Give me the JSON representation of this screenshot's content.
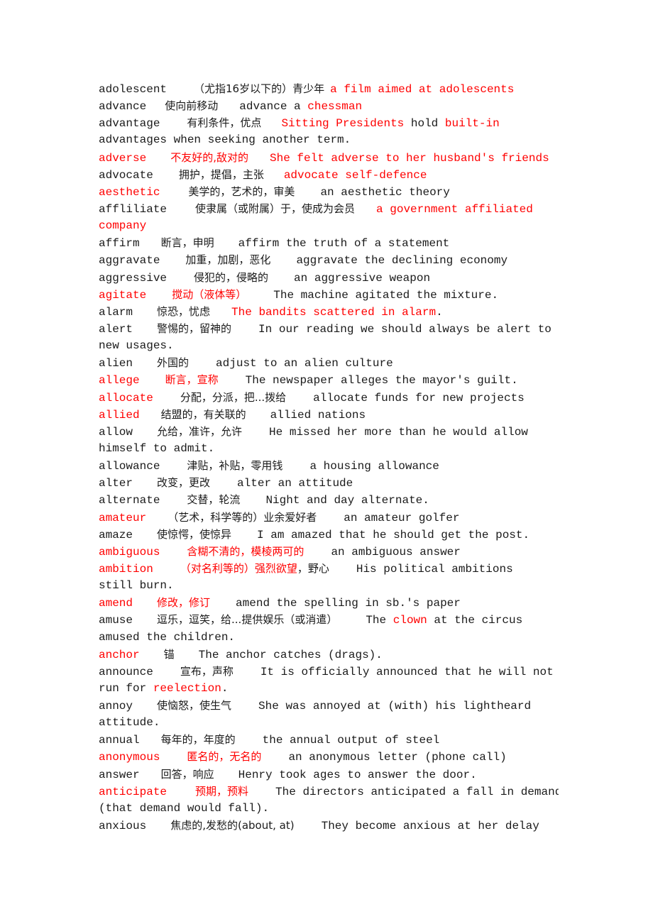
{
  "colors": {
    "text": "#1a1a1a",
    "highlight": "#ff0000"
  },
  "lines": [
    [
      {
        "t": "adolescent"
      },
      {
        "g": 38
      },
      {
        "t": "（尤指16岁以下的）青少年",
        "zh": 1
      },
      {
        "g": 8
      },
      {
        "t": "a film aimed at adolescents",
        "r": 1
      }
    ],
    [
      {
        "t": "advance"
      },
      {
        "g": 26
      },
      {
        "t": "使向前移动",
        "zh": 1
      },
      {
        "g": 30
      },
      {
        "t": "advance a "
      },
      {
        "t": "chessman",
        "r": 1
      }
    ],
    [
      {
        "t": "advantage"
      },
      {
        "g": 38
      },
      {
        "t": "有利条件，优点",
        "zh": 1
      },
      {
        "g": 28
      },
      {
        "t": "Sitting Presidents",
        "r": 1
      },
      {
        "t": " hold "
      },
      {
        "t": "built-in",
        "r": 1
      }
    ],
    [
      {
        "t": "advantages when seeking another term."
      }
    ],
    [
      {
        "t": "adverse",
        "r": 1
      },
      {
        "g": 34
      },
      {
        "t": "不友好的,敌对的",
        "zh": 1,
        "r": 1
      },
      {
        "g": 30
      },
      {
        "t": "She felt adverse to her husband's friends",
        "r": 1
      }
    ],
    [
      {
        "t": "advocate"
      },
      {
        "g": 36
      },
      {
        "t": "拥护，提倡，主张",
        "zh": 1
      },
      {
        "g": 28
      },
      {
        "t": "advocate self-defence",
        "r": 1
      }
    ],
    [
      {
        "t": "aesthetic",
        "r": 1
      },
      {
        "g": 40
      },
      {
        "t": "美学的，艺术的，审美",
        "zh": 1
      },
      {
        "g": 36
      },
      {
        "t": "an aesthetic theory"
      }
    ],
    [
      {
        "t": "affliliate"
      },
      {
        "g": 40
      },
      {
        "t": "使隶属（或附属）于，使成为会员",
        "zh": 1
      },
      {
        "g": 30
      },
      {
        "t": "a government affiliated",
        "r": 1
      }
    ],
    [
      {
        "t": "company",
        "r": 1
      }
    ],
    [
      {
        "t": "affirm"
      },
      {
        "g": 30
      },
      {
        "t": "断言，申明",
        "zh": 1
      },
      {
        "g": 34
      },
      {
        "t": "affirm the truth of a statement"
      }
    ],
    [
      {
        "t": "aggravate"
      },
      {
        "g": 36
      },
      {
        "t": "加重，加剧，恶化",
        "zh": 1
      },
      {
        "g": 36
      },
      {
        "t": "aggravate the declining economy"
      }
    ],
    [
      {
        "t": "aggressive"
      },
      {
        "g": 38
      },
      {
        "t": "侵犯的，侵略的",
        "zh": 1
      },
      {
        "g": 36
      },
      {
        "t": "an aggressive weapon"
      }
    ],
    [
      {
        "t": "agitate",
        "r": 1
      },
      {
        "g": 36
      },
      {
        "t": "搅动（液体等）",
        "zh": 1,
        "r": 1
      },
      {
        "g": 38
      },
      {
        "t": "The machine agitated the mixture."
      }
    ],
    [
      {
        "t": "alarm"
      },
      {
        "g": 34
      },
      {
        "t": "惊恐，忧虑",
        "zh": 1
      },
      {
        "g": 30
      },
      {
        "t": "The bandits scattered in alarm",
        "r": 1
      },
      {
        "t": "."
      }
    ],
    [
      {
        "t": "alert"
      },
      {
        "g": 34
      },
      {
        "t": "警惕的，留神的",
        "zh": 1
      },
      {
        "g": 38
      },
      {
        "t": "In our reading we should always be alert to"
      }
    ],
    [
      {
        "t": "new usages."
      }
    ],
    [
      {
        "t": "alien"
      },
      {
        "g": 34
      },
      {
        "t": "外国的",
        "zh": 1
      },
      {
        "g": 38
      },
      {
        "t": "adjust to an alien culture"
      }
    ],
    [
      {
        "t": "allege",
        "r": 1
      },
      {
        "g": 36
      },
      {
        "t": "断言，宣称",
        "zh": 1,
        "r": 1
      },
      {
        "g": 38
      },
      {
        "t": "The newspaper alleges the mayor's guilt."
      }
    ],
    [
      {
        "t": "allocate",
        "r": 1
      },
      {
        "g": 38
      },
      {
        "t": "分配，分派，把...拨给",
        "zh": 1
      },
      {
        "g": 38
      },
      {
        "t": "allocate funds for new projects"
      }
    ],
    [
      {
        "t": "allied",
        "r": 1
      },
      {
        "g": 30
      },
      {
        "t": "结盟的，有关联的",
        "zh": 1
      },
      {
        "g": 34
      },
      {
        "t": "allied nations"
      }
    ],
    [
      {
        "t": "allow"
      },
      {
        "g": 34
      },
      {
        "t": "允给，准许，允许",
        "zh": 1
      },
      {
        "g": 38
      },
      {
        "t": "He missed her more than he would allow"
      }
    ],
    [
      {
        "t": "himself to admit."
      }
    ],
    [
      {
        "t": "allowance"
      },
      {
        "g": 38
      },
      {
        "t": "津贴，补贴，零用钱",
        "zh": 1
      },
      {
        "g": 38
      },
      {
        "t": "a housing allowance"
      }
    ],
    [
      {
        "t": "alter"
      },
      {
        "g": 34
      },
      {
        "t": "改变，更改",
        "zh": 1
      },
      {
        "g": 38
      },
      {
        "t": "alter an attitude"
      }
    ],
    [
      {
        "t": "alternate"
      },
      {
        "g": 38
      },
      {
        "t": "交替，轮流",
        "zh": 1
      },
      {
        "g": 36
      },
      {
        "t": "Night and day alternate."
      }
    ],
    [
      {
        "t": "amateur",
        "r": 1
      },
      {
        "g": 30
      },
      {
        "t": "（艺术，科学等的）业余爱好者",
        "zh": 1
      },
      {
        "g": 38
      },
      {
        "t": "an amateur golfer"
      }
    ],
    [
      {
        "t": "amaze"
      },
      {
        "g": 34
      },
      {
        "t": "使惊愕，使惊异",
        "zh": 1
      },
      {
        "g": 36
      },
      {
        "t": "I am amazed that he should get the post."
      }
    ],
    [
      {
        "t": "ambiguous",
        "r": 1
      },
      {
        "g": 38
      },
      {
        "t": "含糊不清的，模棱两可的",
        "zh": 1,
        "r": 1
      },
      {
        "g": 38
      },
      {
        "t": "an ambiguous answer"
      }
    ],
    [
      {
        "t": "ambition",
        "r": 1
      },
      {
        "g": 38
      },
      {
        "t": "（对名利等的）强烈欲望",
        "zh": 1,
        "r": 1
      },
      {
        "t": "，野心",
        "zh": 1
      },
      {
        "g": 38
      },
      {
        "t": "His political ambitions"
      }
    ],
    [
      {
        "t": "still burn."
      }
    ],
    [
      {
        "t": "amend",
        "r": 1
      },
      {
        "g": 34
      },
      {
        "t": "修改，修订",
        "zh": 1,
        "r": 1
      },
      {
        "g": 36
      },
      {
        "t": "amend the spelling in sb.'s paper"
      }
    ],
    [
      {
        "t": "amuse"
      },
      {
        "g": 34
      },
      {
        "t": "逗乐，逗笑，给...提供娱乐（或消遣）",
        "zh": 1
      },
      {
        "g": 40
      },
      {
        "t": "The "
      },
      {
        "t": "clown",
        "r": 1
      },
      {
        "t": " at the circus"
      }
    ],
    [
      {
        "t": "amused the children."
      }
    ],
    [
      {
        "t": "anchor",
        "r": 1
      },
      {
        "g": 34
      },
      {
        "t": "锚",
        "zh": 1
      },
      {
        "g": 34
      },
      {
        "t": "The anchor catches (drags)."
      }
    ],
    [
      {
        "t": "announce"
      },
      {
        "g": 38
      },
      {
        "t": "宣布，声称",
        "zh": 1
      },
      {
        "g": 38
      },
      {
        "t": "It is officially announced that he will not"
      }
    ],
    [
      {
        "t": "run for "
      },
      {
        "t": "reelection",
        "r": 1
      },
      {
        "t": "."
      }
    ],
    [
      {
        "t": "annoy"
      },
      {
        "g": 34
      },
      {
        "t": "使恼怒，使生气",
        "zh": 1
      },
      {
        "g": 38
      },
      {
        "t": "She was annoyed at (with) his lightheard"
      }
    ],
    [
      {
        "t": "attitude."
      }
    ],
    [
      {
        "t": "annual"
      },
      {
        "g": 30
      },
      {
        "t": "每年的，年度的",
        "zh": 1
      },
      {
        "g": 38
      },
      {
        "t": "the annual output of steel"
      }
    ],
    [
      {
        "t": "anonymous",
        "r": 1
      },
      {
        "g": 38
      },
      {
        "t": "匿名的，无名的",
        "zh": 1,
        "r": 1
      },
      {
        "g": 38
      },
      {
        "t": "an anonymous letter (phone call)"
      }
    ],
    [
      {
        "t": "answer"
      },
      {
        "g": 30
      },
      {
        "t": "回答，响应",
        "zh": 1
      },
      {
        "g": 34
      },
      {
        "t": "Henry took ages to answer the door."
      }
    ],
    [
      {
        "t": "anticipate",
        "r": 1
      },
      {
        "g": 40
      },
      {
        "t": "预期，预料",
        "zh": 1,
        "r": 1
      },
      {
        "g": 38
      },
      {
        "t": "The directors anticipated a fall in demand"
      }
    ],
    [
      {
        "t": "(that demand would fall)."
      }
    ],
    [
      {
        "t": "anxious"
      },
      {
        "g": 34
      },
      {
        "t": "焦虑的,发愁的(about, at)",
        "zh": 1
      },
      {
        "g": 38
      },
      {
        "t": "They become anxious at her delay"
      }
    ]
  ]
}
